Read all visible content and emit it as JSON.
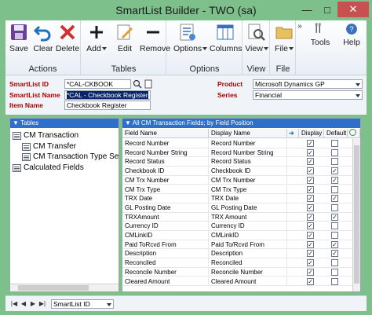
{
  "window": {
    "title": "SmartList Builder  -  TWO (sa)"
  },
  "ribbon": {
    "groups": [
      {
        "label": "Actions",
        "buttons": [
          "Save",
          "Clear",
          "Delete"
        ]
      },
      {
        "label": "Tables",
        "buttons": [
          "Add",
          "Edit",
          "Remove"
        ]
      },
      {
        "label": "Options",
        "buttons": [
          "Options",
          "Columns"
        ]
      },
      {
        "label": "View",
        "buttons": [
          "View"
        ]
      },
      {
        "label": "File",
        "buttons": [
          "File"
        ]
      },
      {
        "label": "",
        "buttons": [
          "Tools"
        ]
      },
      {
        "label": "",
        "buttons": [
          "Help"
        ]
      }
    ]
  },
  "header": {
    "smartlist_id_label": "SmartList ID",
    "smartlist_id_value": "*CAL-CKBOOK",
    "smartlist_name_label": "SmartList Name",
    "smartlist_name_value": "*CAL - Checkbook Register",
    "item_name_label": "Item Name",
    "item_name_value": "Checkbook Register",
    "product_label": "Product",
    "product_value": "Microsoft Dynamics GP",
    "series_label": "Series",
    "series_value": "Financial"
  },
  "tables_pane": {
    "header": "Tables",
    "items": [
      "CM Transaction",
      "CM Transfer",
      "CM Transaction Type Se",
      "Calculated Fields"
    ]
  },
  "fields_pane": {
    "header": "All CM Transaction Fields; by Field Position",
    "columns": [
      "Field Name",
      "Display Name",
      "Display",
      "Default"
    ],
    "rows": [
      {
        "field": "Record Number",
        "display_name": "Record Number",
        "display": true,
        "default": false
      },
      {
        "field": "Record Number String",
        "display_name": "Record Number String",
        "display": true,
        "default": false
      },
      {
        "field": "Record Status",
        "display_name": "Record Status",
        "display": true,
        "default": false
      },
      {
        "field": "Checkbook ID",
        "display_name": "Checkbook ID",
        "display": true,
        "default": true
      },
      {
        "field": "CM Trx Number",
        "display_name": "CM Trx Number",
        "display": true,
        "default": true
      },
      {
        "field": "CM Trx Type",
        "display_name": "CM Trx Type",
        "display": true,
        "default": false
      },
      {
        "field": "TRX Date",
        "display_name": "TRX Date",
        "display": true,
        "default": true
      },
      {
        "field": "GL Posting Date",
        "display_name": "GL Posting Date",
        "display": true,
        "default": false
      },
      {
        "field": "TRXAmount",
        "display_name": "TRX Amount",
        "display": true,
        "default": true
      },
      {
        "field": "Currency ID",
        "display_name": "Currency ID",
        "display": true,
        "default": false
      },
      {
        "field": "CMLinkID",
        "display_name": "CMLinkID",
        "display": true,
        "default": false
      },
      {
        "field": "Paid ToRcvd From",
        "display_name": "Paid To/Rcvd From",
        "display": true,
        "default": true
      },
      {
        "field": "Description",
        "display_name": "Description",
        "display": true,
        "default": true
      },
      {
        "field": "Reconciled",
        "display_name": "Reconciled",
        "display": true,
        "default": false
      },
      {
        "field": "Reconcile Number",
        "display_name": "Reconcile Number",
        "display": true,
        "default": false
      },
      {
        "field": "Cleared Amount",
        "display_name": "Cleared Amount",
        "display": true,
        "default": false
      }
    ]
  },
  "footer": {
    "sort_value": "SmartList ID"
  },
  "colors": {
    "window_frame": "#7ec08c",
    "pane_header": "#2e6fc9",
    "label_red": "#b00000"
  }
}
